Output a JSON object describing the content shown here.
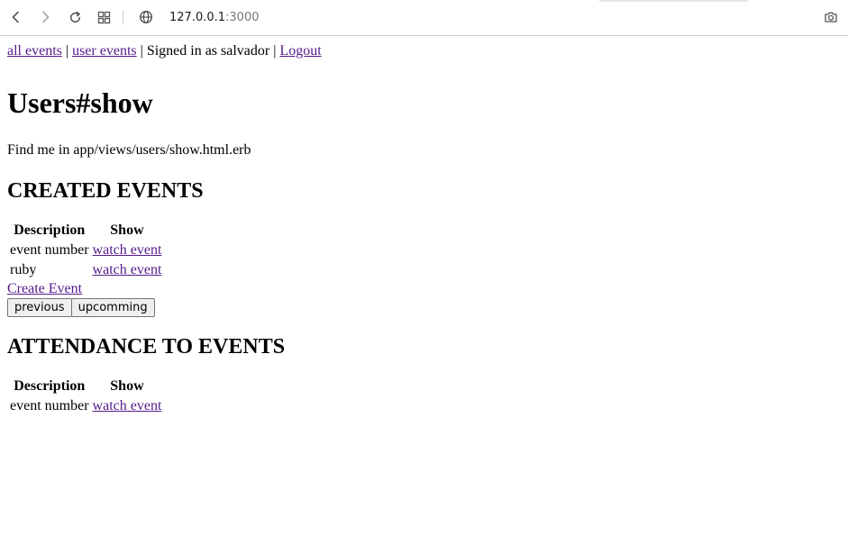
{
  "browser": {
    "address_host": "127.0.0.1",
    "address_port": ":3000"
  },
  "nav": {
    "all_events": "all events",
    "sep1": " | ",
    "user_events": "user events",
    "signed_in": " | Signed in as salvador | ",
    "logout": "Logout"
  },
  "title": "Users#show",
  "hint": "Find me in app/views/users/show.html.erb",
  "created": {
    "heading": "CREATED EVENTS",
    "col_description": "Description",
    "col_show": "Show",
    "rows": [
      {
        "description": "event number",
        "link": "watch event"
      },
      {
        "description": "ruby",
        "link": "watch event"
      }
    ],
    "create_link": "Create Event",
    "prev_button": "previous",
    "next_button": "upcomming"
  },
  "attendance": {
    "heading": "ATTENDANCE TO EVENTS",
    "col_description": "Description",
    "col_show": "Show",
    "rows": [
      {
        "description": "event number",
        "link": "watch event"
      }
    ]
  },
  "icons": {
    "back": "arrow-left-icon",
    "forward": "arrow-right-icon",
    "reload": "reload-icon",
    "tabs": "grid-icon",
    "site_info": "globe-icon",
    "screenshot": "camera-icon"
  }
}
